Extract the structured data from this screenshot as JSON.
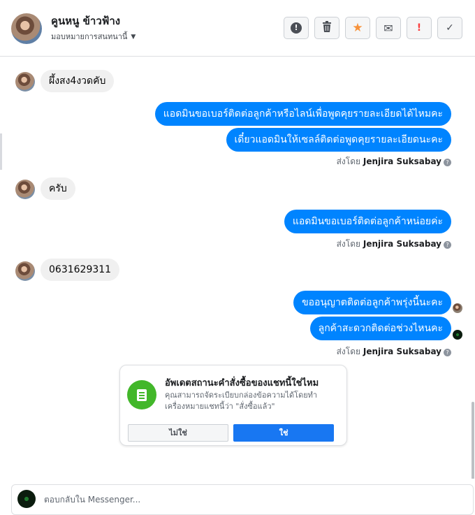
{
  "header": {
    "contact_name": "คูนหนู ข้าวฟ้าง",
    "assign_label": "มอบหมายการสนทนานี้",
    "toolbar": [
      {
        "icon": "alert-circle-icon",
        "glyph": "!",
        "color": "#4b4f56"
      },
      {
        "icon": "trash-icon",
        "glyph": "🗑",
        "color": "#4b4f56"
      },
      {
        "icon": "star-icon",
        "glyph": "★",
        "color": "#f7923b"
      },
      {
        "icon": "envelope-icon",
        "glyph": "✉",
        "color": "#4b4f56"
      },
      {
        "icon": "spam-icon",
        "glyph": "!",
        "color": "#fa3e3e"
      },
      {
        "icon": "check-icon",
        "glyph": "✓",
        "color": "#4b4f56"
      }
    ]
  },
  "thread": {
    "top_fade": "ʻ  ʻ",
    "messages": [
      {
        "kind": "in",
        "text": "ผึ้งสง4งวดคับ"
      },
      {
        "kind": "out",
        "text": "แอดมินขอเบอร์ติดต่อลูกค้าหรือไลน์เพื่อพูดคุยรายละเอียดได้ไหมคะ"
      },
      {
        "kind": "out",
        "text": "เดี๋ยวแอดมินให้เซลล์ติดต่อพูดคุยรายละเอียดนะคะ"
      },
      {
        "kind": "in",
        "text": "ครับ"
      },
      {
        "kind": "out",
        "text": "แอดมินขอเบอร์ติดต่อลูกค้าหน่อยค่ะ"
      },
      {
        "kind": "in",
        "text": "0631629311"
      },
      {
        "kind": "out",
        "text": "ขออนุญาตติดต่อลูกค้าพรุ่งนี้นะคะ"
      },
      {
        "kind": "out",
        "text": "ลูกค้าสะดวกติดต่อช่วงไหนคะ"
      }
    ],
    "sent_by_prefix": "ส่งโดย",
    "sent_by_name": "Jenjira Suksabay",
    "help_glyph": "?"
  },
  "status_card": {
    "title": "อัพเดตสถานะคำสั่งซื้อของแชทนี้ใช่ไหม",
    "description": "คุณสามารถจัดระเบียบกล่องข้อความได้โดยทำเครื่องหมายแชทนี้ว่า \"สั่งซื้อแล้ว\"",
    "no_label": "ไม่ใช่",
    "yes_label": "ใช่",
    "icon": "order-receipt-icon"
  },
  "composer": {
    "placeholder": "ตอบกลับใน Messenger..."
  },
  "colors": {
    "outgoing_bubble": "#0084ff",
    "incoming_bubble": "#f0f0f0",
    "primary_button": "#1877f2",
    "card_icon_bg": "#42b72a"
  }
}
